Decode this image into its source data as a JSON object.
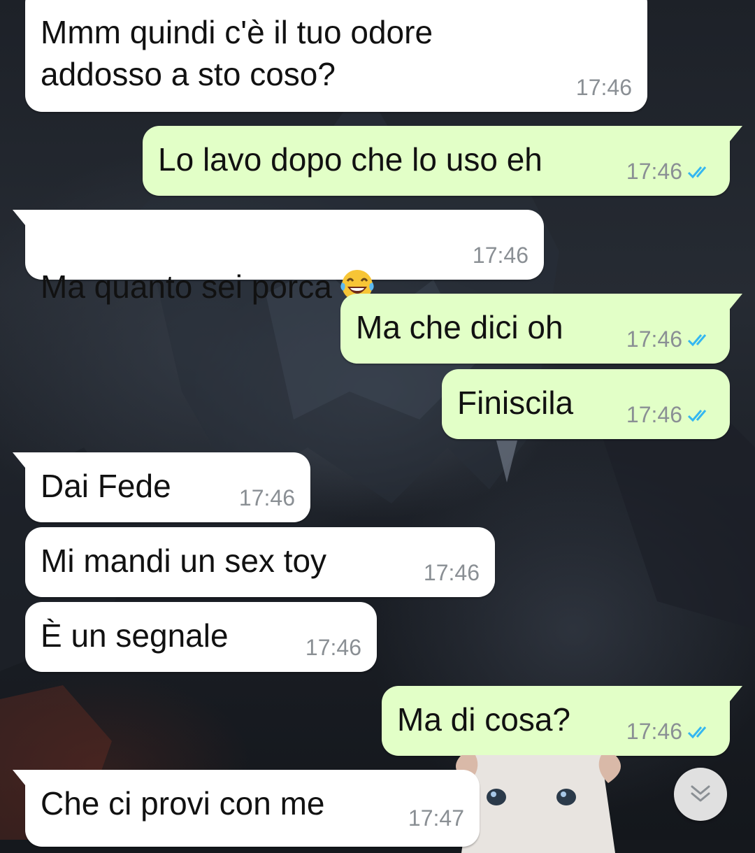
{
  "colors": {
    "incoming_bubble": "#ffffff",
    "outgoing_bubble": "#e2ffc7",
    "timestamp": "#8a8f94",
    "read_ticks": "#34b7f1"
  },
  "messages": [
    {
      "direction": "incoming",
      "text": "Mmm quindi c'è il tuo odore\naddosso a sto coso?",
      "time": "17:46"
    },
    {
      "direction": "outgoing",
      "text": "Lo lavo dopo che lo uso eh",
      "time": "17:46",
      "status": "read"
    },
    {
      "direction": "incoming",
      "text": "Ma quanto sei porca",
      "emoji": "face-with-tears-of-joy",
      "time": "17:46"
    },
    {
      "direction": "outgoing",
      "text": "Ma che dici oh",
      "time": "17:46",
      "status": "read"
    },
    {
      "direction": "outgoing",
      "text": "Finiscila",
      "time": "17:46",
      "status": "read"
    },
    {
      "direction": "incoming",
      "text": "Dai Fede",
      "time": "17:46"
    },
    {
      "direction": "incoming",
      "text": "Mi mandi un sex toy",
      "time": "17:46"
    },
    {
      "direction": "incoming",
      "text": "È un segnale",
      "time": "17:46"
    },
    {
      "direction": "outgoing",
      "text": "Ma di cosa?",
      "time": "17:46",
      "status": "read"
    },
    {
      "direction": "incoming",
      "text": "Che ci provi con me",
      "time": "17:47"
    }
  ],
  "scroll_button": {
    "icon": "double-chevron-down-icon"
  }
}
